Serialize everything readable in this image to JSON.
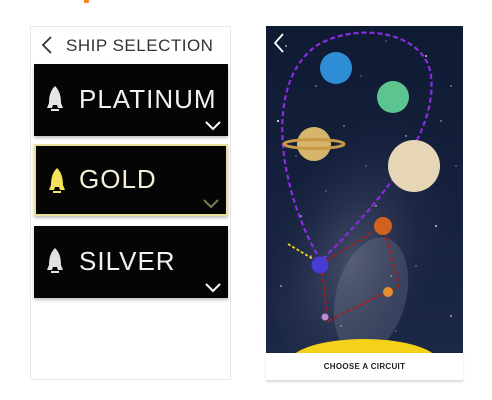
{
  "selection_screen": {
    "title": "SHIP SELECTION",
    "cards": [
      {
        "label": "PLATINUM",
        "rocket_color": "#e6e6e6"
      },
      {
        "label": "GOLD",
        "rocket_color": "#f4e25a"
      },
      {
        "label": "SILVER",
        "rocket_color": "#e0e0e0"
      }
    ]
  },
  "map_screen": {
    "choose_label": "CHOOSE A CIRCUIT"
  },
  "colors": {
    "accent": "#f08a24",
    "card_bg": "#050505",
    "gold_border": "#eadf9a",
    "space_bg": "#13203a",
    "purple_path": "#8a2be2",
    "red_path": "#b01818",
    "sun": "#f5d21a"
  },
  "icons": [
    "back-arrow-icon",
    "rocket-icon",
    "chevron-down-icon",
    "moon-icon"
  ]
}
